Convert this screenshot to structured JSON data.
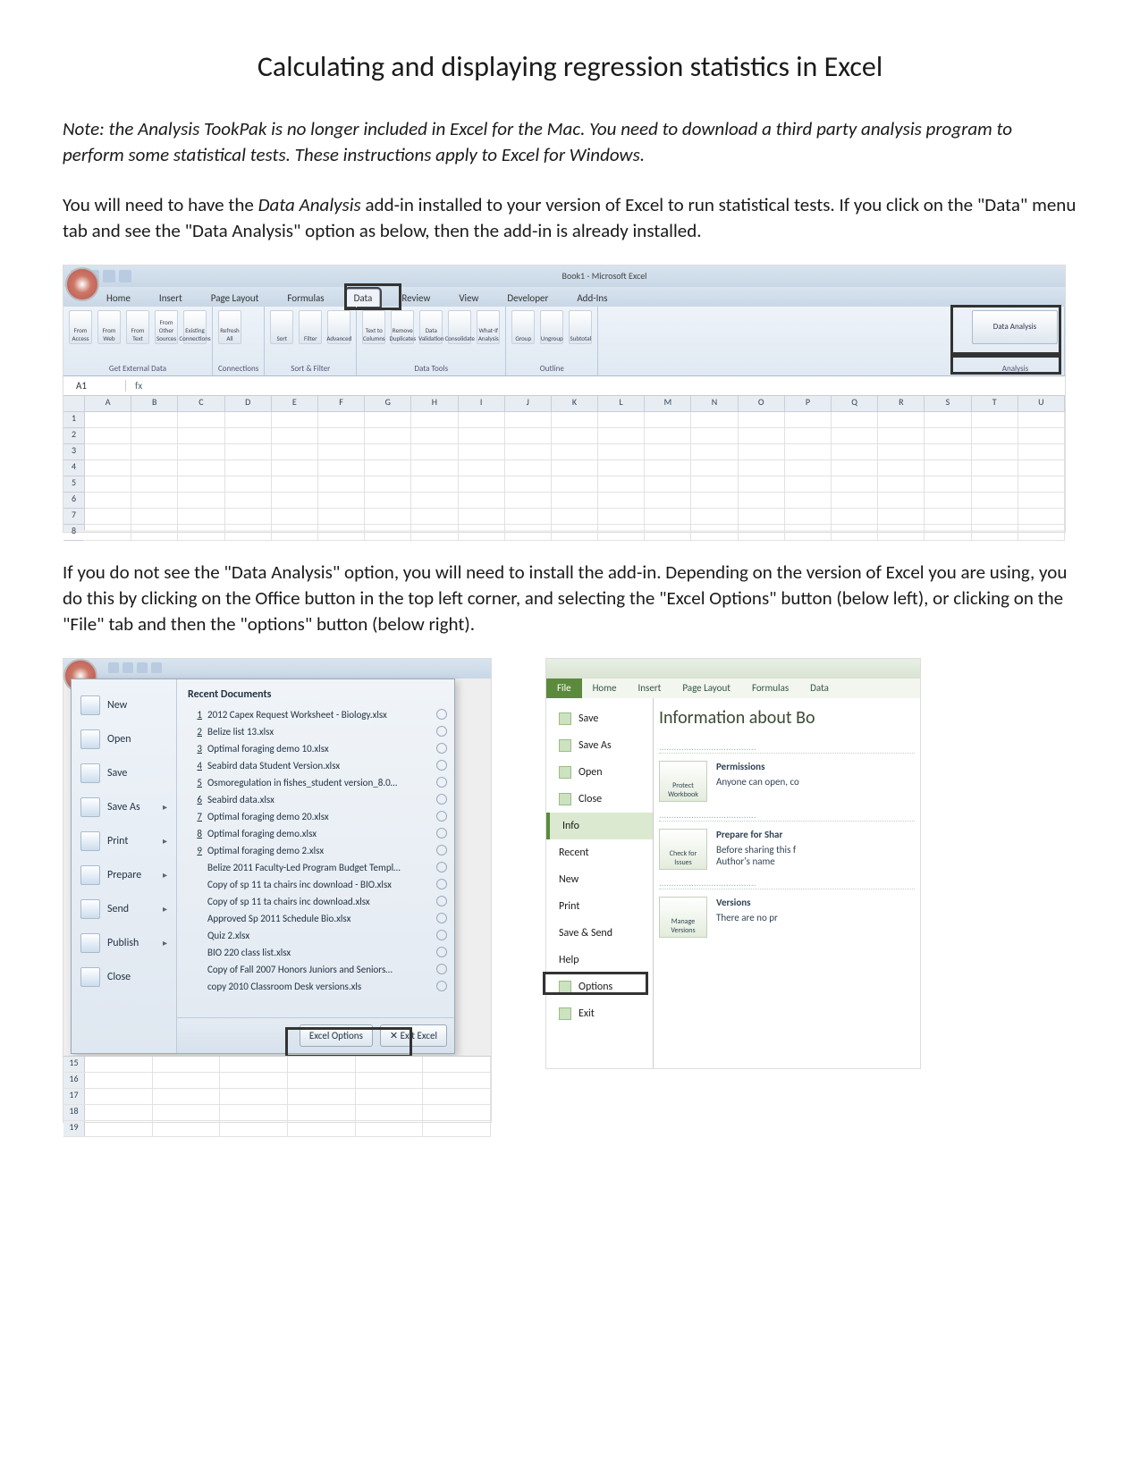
{
  "title": "Calculating and displaying regression statistics in Excel",
  "note": "Note: the Analysis TookPak is no longer included in Excel for the Mac. You need to download a third party analysis program to perform some statistical tests. These instructions apply to Excel for Windows.",
  "p1_a": "You will need to have the ",
  "p1_em": "Data Analysis",
  "p1_b": " add-in installed to your version of Excel to run statistical tests. If you click on the \"Data\" menu tab and see the \"Data Analysis\" option as below, then the add-in is already installed.",
  "p2": "If you do not see the \"Data Analysis\" option, you will need to install the add-in. Depending on the version of Excel you are using, you do this by clicking on the Office button in the top left corner, and selecting the \"Excel Options\" button (below left), or clicking on the \"File\" tab and then the \"options\" button (below right).",
  "shot1": {
    "window_title": "Book1 - Microsoft Excel",
    "tabs": [
      "Home",
      "Insert",
      "Page Layout",
      "Formulas",
      "Data",
      "Review",
      "View",
      "Developer",
      "Add-Ins"
    ],
    "active_tab_index": 4,
    "groups": {
      "get_external": {
        "label": "Get External Data",
        "items": [
          "From Access",
          "From Web",
          "From Text",
          "From Other Sources",
          "Existing Connections"
        ]
      },
      "connections": {
        "label": "Connections",
        "items": [
          "Refresh All"
        ]
      },
      "sort_filter": {
        "label": "Sort & Filter",
        "items": [
          "Sort",
          "Filter",
          "Advanced"
        ]
      },
      "data_tools": {
        "label": "Data Tools",
        "items": [
          "Text to Columns",
          "Remove Duplicates",
          "Data Validation",
          "Consolidate",
          "What-If Analysis"
        ]
      },
      "outline": {
        "label": "Outline",
        "items": [
          "Group",
          "Ungroup",
          "Subtotal"
        ]
      },
      "analysis": {
        "label": "Analysis",
        "button": "Data Analysis"
      }
    },
    "namebox": "A1",
    "fx": "fx",
    "cols": [
      "A",
      "B",
      "C",
      "D",
      "E",
      "F",
      "G",
      "H",
      "I",
      "J",
      "K",
      "L",
      "M",
      "N",
      "O",
      "P",
      "Q",
      "R",
      "S",
      "T",
      "U"
    ],
    "rows": [
      "1",
      "2",
      "3",
      "4",
      "5",
      "6",
      "7",
      "8"
    ]
  },
  "shot2": {
    "menu_left": [
      "New",
      "Open",
      "Save",
      "Save As",
      "Print",
      "Prepare",
      "Send",
      "Publish",
      "Close"
    ],
    "arrows": [
      "Save As",
      "Print",
      "Prepare",
      "Send",
      "Publish"
    ],
    "recent_header": "Recent Documents",
    "recent_docs": [
      "2012 Capex Request Worksheet - Biology.xlsx",
      "Belize list 13.xlsx",
      "Optimal foraging demo 10.xlsx",
      "Seabird data Student Version.xlsx",
      "Osmoregulation in fishes_student version_8.0…",
      "Seabird data.xlsx",
      "Optimal foraging demo 20.xlsx",
      "Optimal foraging demo.xlsx",
      "Optimal foraging demo 2.xlsx",
      "Belize 2011 Faculty-Led Program Budget Templ…",
      "Copy of sp 11 ta chairs inc download - BIO.xlsx",
      "Copy of sp 11 ta chairs inc download.xlsx",
      "Approved Sp 2011 Schedule Bio.xlsx",
      "Quiz 2.xlsx",
      "BIO 220 class list.xlsx",
      "Copy of Fall 2007 Honors Juniors and Seniors…",
      "copy 2010 Classroom Desk versions.xls"
    ],
    "excel_options_label": "Excel Options",
    "exit_label": "Exit Excel",
    "grid_rows": [
      "15",
      "16",
      "17",
      "18",
      "19"
    ]
  },
  "shot3": {
    "tabs": [
      "File",
      "Home",
      "Insert",
      "Page Layout",
      "Formulas",
      "Data"
    ],
    "left_items_top": [
      "Save",
      "Save As",
      "Open",
      "Close"
    ],
    "info_label": "Info",
    "left_items_mid": [
      "Recent",
      "New",
      "Print",
      "Save & Send",
      "Help"
    ],
    "options_label": "Options",
    "exit_label": "Exit",
    "right": {
      "title": "Information about Bo",
      "perm_h": "Permissions",
      "perm_t": "Anyone can open, co",
      "perm_box": "Protect Workbook",
      "share_h": "Prepare for Shar",
      "share_t": "Before sharing this f",
      "share_t2": "Author's name",
      "share_box": "Check for Issues",
      "ver_h": "Versions",
      "ver_t": "There are no pr",
      "ver_box": "Manage Versions"
    }
  }
}
